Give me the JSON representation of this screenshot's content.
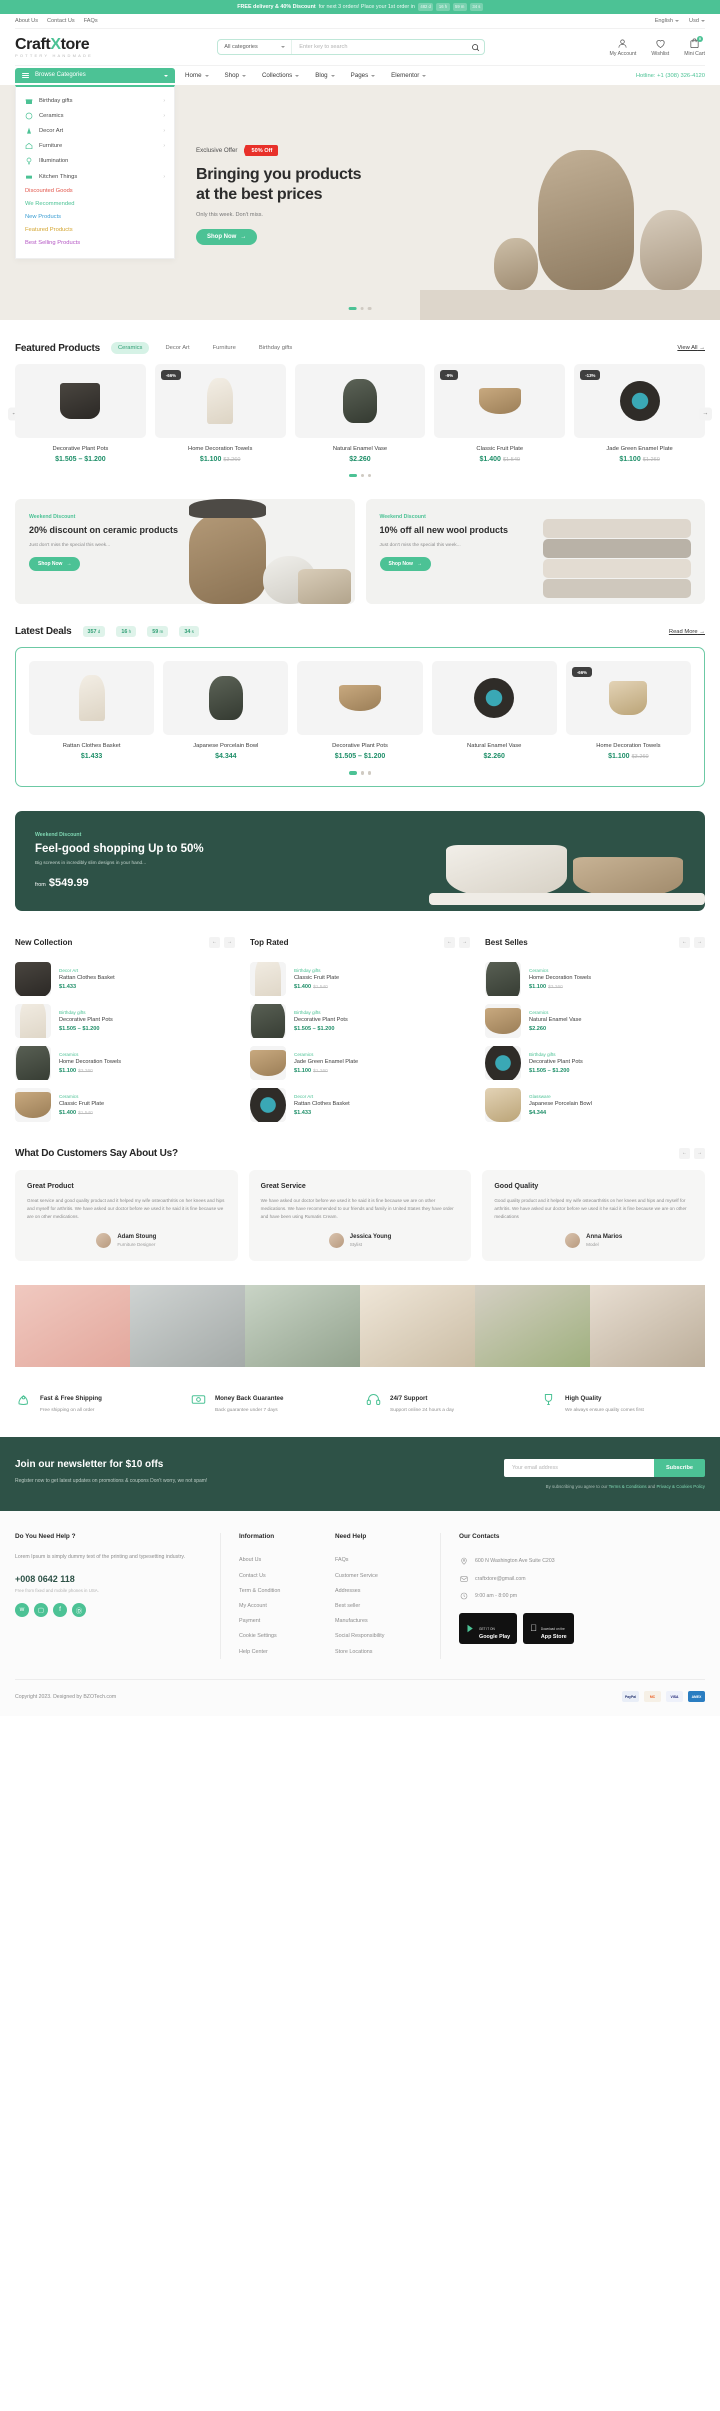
{
  "announcement": {
    "bold": "FREE delivery & 40% Discount",
    "rest": "for next 3 orders! Place your 1st order in",
    "timer": [
      {
        "v": "482",
        "u": "d"
      },
      {
        "v": "16",
        "u": "h"
      },
      {
        "v": "59",
        "u": "m"
      },
      {
        "v": "34",
        "u": "s"
      }
    ]
  },
  "utility": {
    "links": [
      "About Us",
      "Contact Us",
      "FAQs"
    ],
    "language": "English",
    "currency": "Usd"
  },
  "brand": {
    "name_part1": "Craft",
    "name_x": "X",
    "name_part2": "tore",
    "tagline": "POTTERY HANDMADE"
  },
  "search": {
    "category": "All categories",
    "placeholder": "Enter key to search",
    "icon": "search-icon"
  },
  "header_icons": [
    {
      "label": "My Account",
      "icon": "user-icon",
      "badge": ""
    },
    {
      "label": "Wishlist",
      "icon": "heart-icon",
      "badge": ""
    },
    {
      "label": "Mini Cart",
      "icon": "cart-icon",
      "badge": "0"
    }
  ],
  "nav": {
    "browse": "Browse Categories",
    "links": [
      "Home",
      "Shop",
      "Collections",
      "Blog",
      "Pages",
      "Elementor"
    ],
    "hotline": "Hotline: +1 (308) 326-4120"
  },
  "categories": {
    "items": [
      {
        "label": "Birthday gifts",
        "icon": "gift-icon",
        "arrow": true
      },
      {
        "label": "Ceramics",
        "icon": "ceramic-icon",
        "arrow": true
      },
      {
        "label": "Decor Art",
        "icon": "decor-icon",
        "arrow": true
      },
      {
        "label": "Furniture",
        "icon": "furniture-icon",
        "arrow": true
      },
      {
        "label": "Illumination",
        "icon": "lamp-icon",
        "arrow": false
      },
      {
        "label": "Kitchen Things",
        "icon": "kitchen-icon",
        "arrow": true
      }
    ],
    "promo_links": [
      {
        "label": "Discounted Goods",
        "color": "#e2574c"
      },
      {
        "label": "We Recommended",
        "color": "#4cc295"
      },
      {
        "label": "New Products",
        "color": "#3d9fd4"
      },
      {
        "label": "Featured Products",
        "color": "#d4a531"
      },
      {
        "label": "Best Selling Products",
        "color": "#b457c4"
      }
    ]
  },
  "hero": {
    "offer_label": "Exclusive Offer",
    "badge": "50% Off",
    "title_line1": "Bringing you products",
    "title_line2": "at the best prices",
    "subtitle": "Only this week. Don't miss.",
    "cta": "Shop Now",
    "slides": 3,
    "active_slide": 1
  },
  "featured": {
    "title": "Featured Products",
    "tabs": [
      "Ceramics",
      "Decor Art",
      "Furniture",
      "Birthday gifts"
    ],
    "active_tab": "Ceramics",
    "view_all": "View All",
    "products": [
      {
        "name": "Decorative Plant Pots",
        "price": "$1.505 – $1.200",
        "old": "",
        "discount": ""
      },
      {
        "name": "Home Decoration Towels",
        "price": "$1.100",
        "old": "$3.260",
        "discount": "-66%"
      },
      {
        "name": "Natural Enamel Vase",
        "price": "$2.260",
        "old": "",
        "discount": ""
      },
      {
        "name": "Classic Fruit Plate",
        "price": "$1.400",
        "old": "$1.540",
        "discount": "-9%"
      },
      {
        "name": "Jade Green Enamel Plate",
        "price": "$1.100",
        "old": "$1.260",
        "discount": "-13%"
      }
    ]
  },
  "promos": [
    {
      "kicker": "Weekend Discount",
      "title": "20% discount on ceramic products",
      "text": "Just don't miss the special this week...",
      "cta": "Shop Now"
    },
    {
      "kicker": "Weekend Discount",
      "title": "10% off all new wool products",
      "text": "Just don't miss the special this week...",
      "cta": "Shop Now"
    }
  ],
  "deals": {
    "title": "Latest Deals",
    "timer": [
      {
        "v": "357",
        "u": "d"
      },
      {
        "v": "16",
        "u": "h"
      },
      {
        "v": "59",
        "u": "m"
      },
      {
        "v": "34",
        "u": "s"
      }
    ],
    "read_more": "Read More",
    "products": [
      {
        "name": "Rattan Clothes Basket",
        "price": "$1.433",
        "old": "",
        "discount": ""
      },
      {
        "name": "Japanese Porcelain Bowl",
        "price": "$4.344",
        "old": "",
        "discount": ""
      },
      {
        "name": "Decorative Plant Pots",
        "price": "$1.505 – $1.200",
        "old": "",
        "discount": ""
      },
      {
        "name": "Natural Enamel Vase",
        "price": "$2.260",
        "old": "",
        "discount": ""
      },
      {
        "name": "Home Decoration Towels",
        "price": "$1.100",
        "old": "$3.260",
        "discount": "-66%"
      }
    ]
  },
  "dark_banner": {
    "kicker": "Weekend Discount",
    "title": "Feel-good shopping Up to 50%",
    "text": "Big screens in incredibly slim designs in your hand...",
    "from_label": "from",
    "price": "$549.99"
  },
  "columns": [
    {
      "title": "New Collection",
      "items": [
        {
          "cat": "Decor Art",
          "name": "Rattan Clothes Basket",
          "price": "$1.433",
          "old": ""
        },
        {
          "cat": "Birthday gifts",
          "name": "Decorative Plant Pots",
          "price": "$1.505 – $1.200",
          "old": ""
        },
        {
          "cat": "Ceramics",
          "name": "Home Decoration Towels",
          "price": "$1.100",
          "old": "$3.260"
        },
        {
          "cat": "Ceramics",
          "name": "Classic Fruit Plate",
          "price": "$1.400",
          "old": "$1.540"
        }
      ]
    },
    {
      "title": "Top Rated",
      "items": [
        {
          "cat": "Birthday gifts",
          "name": "Classic Fruit Plate",
          "price": "$1.400",
          "old": "$1.540"
        },
        {
          "cat": "Birthday gifts",
          "name": "Decorative Plant Pots",
          "price": "$1.505 – $1.200",
          "old": ""
        },
        {
          "cat": "Ceramics",
          "name": "Jade Green Enamel Plate",
          "price": "$1.100",
          "old": "$1.260"
        },
        {
          "cat": "Decor Art",
          "name": "Rattan Clothes Basket",
          "price": "$1.433",
          "old": ""
        }
      ]
    },
    {
      "title": "Best Selles",
      "items": [
        {
          "cat": "Ceramics",
          "name": "Home Decoration Towels",
          "price": "$1.100",
          "old": "$3.260"
        },
        {
          "cat": "Ceramics",
          "name": "Natural Enamel Vase",
          "price": "$2.260",
          "old": ""
        },
        {
          "cat": "Birthday gifts",
          "name": "Decorative Plant Pots",
          "price": "$1.505 – $1.200",
          "old": ""
        },
        {
          "cat": "Glassware",
          "name": "Japanese Porcelain Bowl",
          "price": "$4.344",
          "old": ""
        }
      ]
    }
  ],
  "testimonials": {
    "title": "What Do Customers Say About Us?",
    "cards": [
      {
        "heading": "Great Product",
        "body": "Great service and good quality product and it helped my wife osteoarthritis on her knees and hips and myself for arthritis. We have asked our doctor before we used it he said it is fine because we are on other medications.",
        "name": "Adam Stoung",
        "role": "Furniture Designer"
      },
      {
        "heading": "Great Service",
        "body": "We have asked our doctor before we used it he said it is fine because we are on other medications. We have recommended to our friends and family in United States they have order and have been using Rumatis Cream.",
        "name": "Jessica Young",
        "role": "Stylist"
      },
      {
        "heading": "Good Quality",
        "body": "Good quality product and it helped my wife osteoarthritis on her knees and hips and myself for arthritis. We have asked our doctor before we used it he said it is fine because we are on other medications",
        "name": "Anna Marios",
        "role": "Model"
      }
    ]
  },
  "features": [
    {
      "icon": "rocket-icon",
      "title": "Fast & Free Shipping",
      "sub": "Free shipping on all order"
    },
    {
      "icon": "money-icon",
      "title": "Money Back Guarantee",
      "sub": "Back guarantee under 7 days"
    },
    {
      "icon": "support-icon",
      "title": "24/7 Support",
      "sub": "Support online 24 hours a day"
    },
    {
      "icon": "trophy-icon",
      "title": "High Quality",
      "sub": "We always ensure quality comes first"
    }
  ],
  "newsletter": {
    "title": "Join our newsletter for $10 offs",
    "text": "Register now to get latest updates on promotions & coupons Don't worry, we not spam!",
    "placeholder": "Your email address",
    "button": "Subscribe",
    "note_prefix": "By subscribing you agree to our",
    "note_link1": "Terms & Conditions",
    "note_and": "and",
    "note_link2": "Privacy & Cookies Policy"
  },
  "footer": {
    "help": {
      "title": "Do You Need Help ?",
      "text": "Lorem Ipsum is simply dummy text of the printing and typesetting industry.",
      "phone": "+008 0642 118",
      "note": "Free from fixed and mobile phones in USA.",
      "socials": [
        "twitter-icon",
        "instagram-icon",
        "facebook-icon",
        "pinterest-icon"
      ]
    },
    "information": {
      "title": "Information",
      "links": [
        "About Us",
        "Contact Us",
        "Term & Condition",
        "My Account",
        "Payment",
        "Cookie Settings",
        "Help Center"
      ]
    },
    "need_help": {
      "title": "Need Help",
      "links": [
        "FAQs",
        "Customer Service",
        "Addresses",
        "Best seller",
        "Manufactures",
        "Social Responsibility",
        "Store Locations"
      ]
    },
    "contacts": {
      "title": "Our Contacts",
      "items": [
        {
          "icon": "pin-icon",
          "text": "600 N Washington Ave Suite C203"
        },
        {
          "icon": "mail-icon",
          "text": "craftxtore@gmail.com"
        },
        {
          "icon": "clock-icon",
          "text": "9:00 am - 8:00 pm"
        }
      ],
      "stores": [
        {
          "small": "GET IT ON",
          "big": "Google Play"
        },
        {
          "small": "Download on the",
          "big": "App Store"
        }
      ]
    },
    "copyright": "Copyright 2023. Designed by BZOTech.com",
    "payments": [
      "PayPal",
      "MC",
      "VISA",
      "AMEX"
    ]
  },
  "colors": {
    "brand_green": "#4cc295",
    "dark_green": "#2e5247",
    "red_badge": "#e8312a",
    "price_green": "#1f8f69"
  }
}
